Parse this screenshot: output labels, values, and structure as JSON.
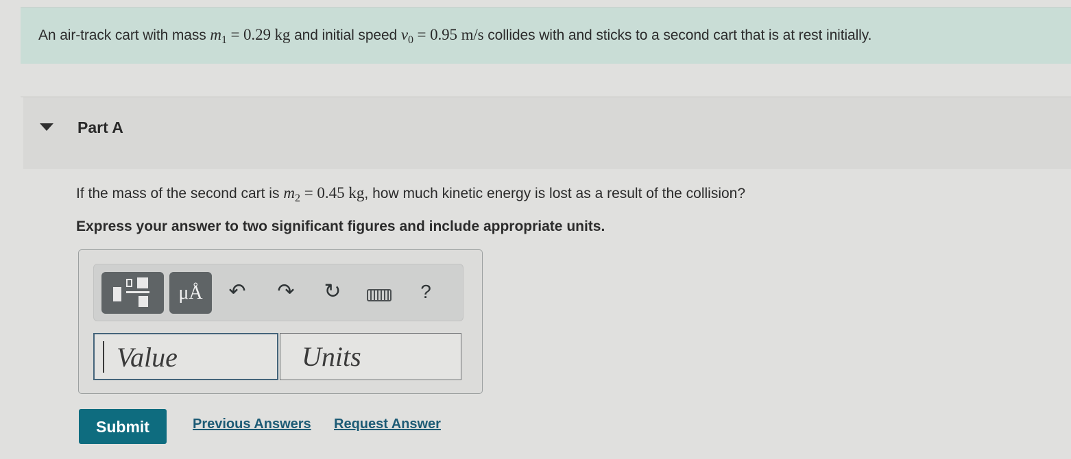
{
  "intro": {
    "text_a": "An air-track cart with mass ",
    "m1_var": "m",
    "m1_sub": "1",
    "m1_eq": " = 0.29 kg",
    "text_b": " and initial speed ",
    "v0_var": "v",
    "v0_sub": "0",
    "v0_eq": " = 0.95 m/s",
    "text_c": " collides with and sticks to a second cart that is at rest initially."
  },
  "part": {
    "title": "Part A",
    "question_a": "If the mass of the second cart is ",
    "m2_var": "m",
    "m2_sub": "2",
    "m2_eq": " = 0.45 kg",
    "question_b": ", how much kinetic energy is lost as a result of the collision?",
    "instructions": "Express your answer to two significant figures and include appropriate units."
  },
  "toolbar": {
    "templates_icon": "fraction-templates-icon",
    "units_label": "μÅ",
    "undo_glyph": "↶",
    "redo_glyph": "↷",
    "reset_glyph": "↻",
    "keyboard_icon": "keyboard-icon",
    "help_glyph": "?"
  },
  "inputs": {
    "value_placeholder": "Value",
    "units_placeholder": "Units"
  },
  "actions": {
    "submit": "Submit",
    "previous_answers": "Previous Answers",
    "request_answer": "Request Answer"
  }
}
